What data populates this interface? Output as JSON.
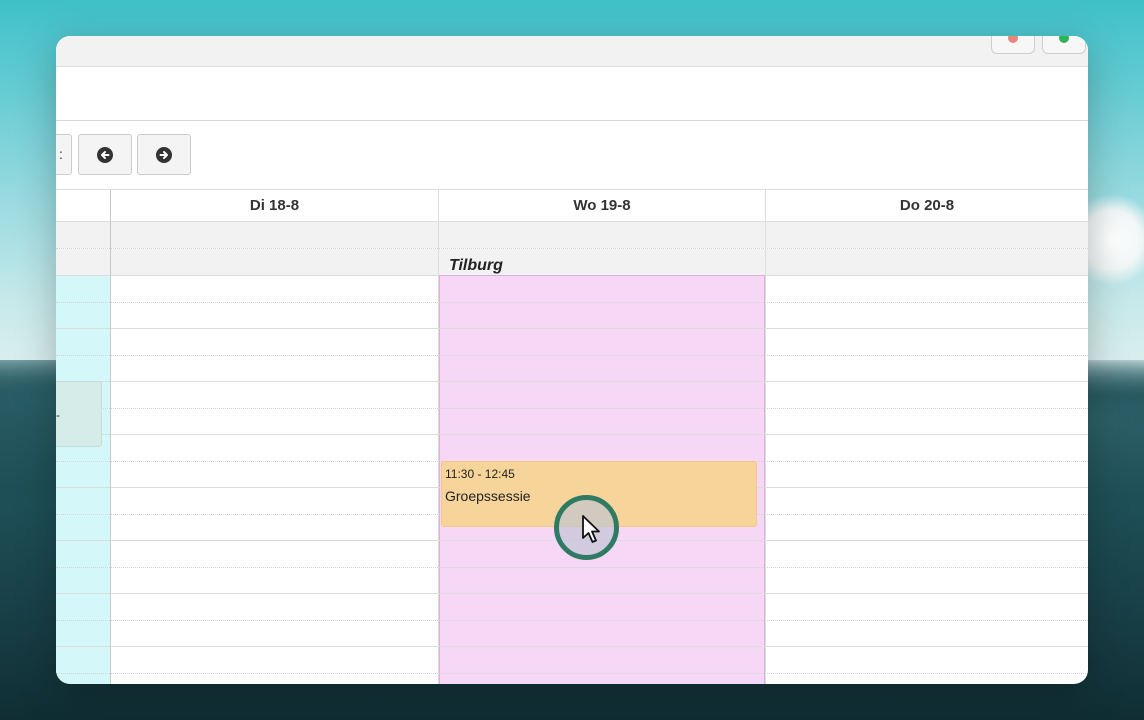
{
  "toolbar": {
    "prev_icon": "arrow-left-circle-icon",
    "next_icon": "arrow-right-circle-icon",
    "partial_label": ":"
  },
  "calendar": {
    "days": [
      {
        "label": "Di 18-8"
      },
      {
        "label": "Wo 19-8"
      },
      {
        "label": "Do 20-8"
      }
    ],
    "location": "Tilburg",
    "event": {
      "time": "11:30 - 12:45",
      "title": "Groepssessie",
      "color": "#f6d49a"
    },
    "monday_event_text": "-",
    "colors": {
      "monday": "#d4f8fa",
      "wednesday": "#f6d8f6",
      "cursor_ring": "#2f7a63"
    }
  }
}
